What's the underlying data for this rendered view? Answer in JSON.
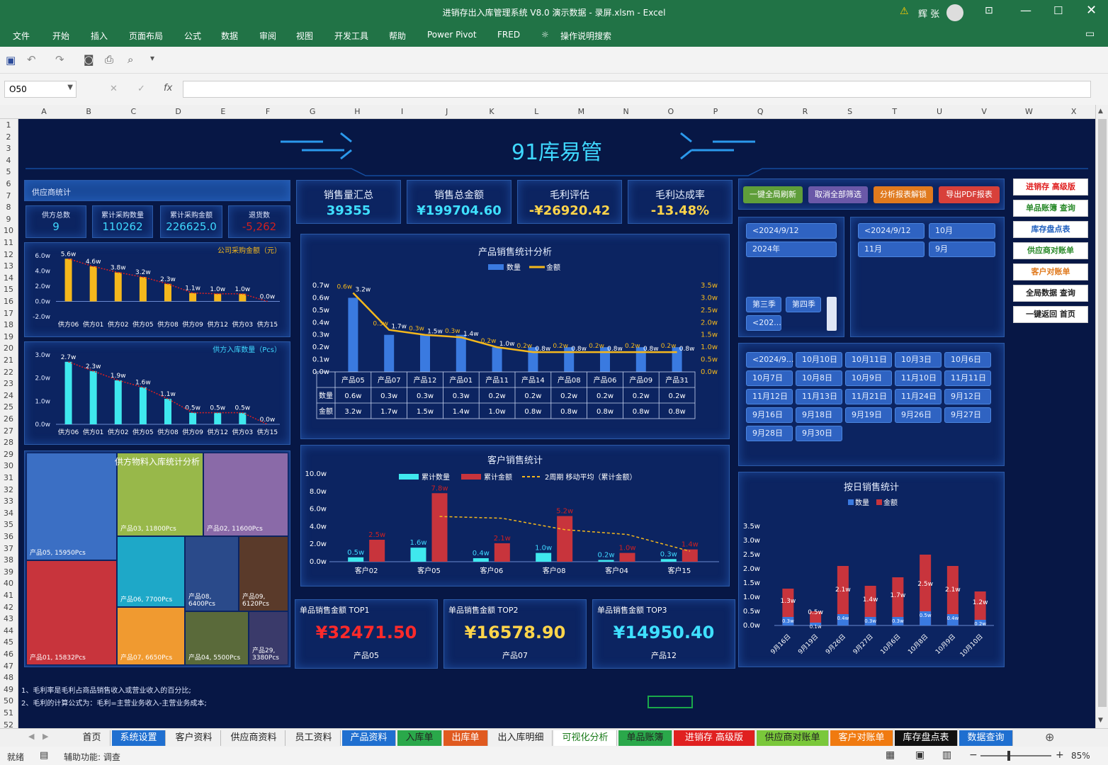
{
  "window": {
    "title": "进销存出入库管理系统 V8.0 演示数据 - 录屏.xlsm  -  Excel",
    "user": "辉 张"
  },
  "ribbon": {
    "tabs": [
      "文件",
      "开始",
      "插入",
      "页面布局",
      "公式",
      "数据",
      "审阅",
      "视图",
      "开发工具",
      "帮助",
      "Power Pivot",
      "FRED"
    ],
    "search": "操作说明搜索"
  },
  "formula": {
    "namebox": "O50",
    "fx": "fx"
  },
  "columns": [
    "A",
    "B",
    "C",
    "D",
    "E",
    "F",
    "G",
    "H",
    "I",
    "J",
    "K",
    "L",
    "M",
    "N",
    "O",
    "P",
    "Q",
    "R",
    "S",
    "T",
    "U",
    "V",
    "W",
    "X"
  ],
  "rows": [
    "1",
    "2",
    "3",
    "4",
    "5",
    "6",
    "7",
    "8",
    "9",
    "10",
    "11",
    "12",
    "13",
    "14",
    "15",
    "16",
    "17",
    "18",
    "19",
    "20",
    "21",
    "22",
    "23",
    "24",
    "25",
    "26",
    "27",
    "28",
    "29",
    "30",
    "31",
    "32",
    "33",
    "34",
    "35",
    "36",
    "37",
    "38",
    "39",
    "40",
    "41",
    "42",
    "43",
    "44",
    "45",
    "46",
    "47",
    "48",
    "49",
    "50",
    "51",
    "52"
  ],
  "dashboard": {
    "title": "91库易管",
    "supplier_header": "供应商统计",
    "supplier_kpis": [
      {
        "label": "供方总数",
        "value": "9"
      },
      {
        "label": "累计采购数量",
        "value": "110262"
      },
      {
        "label": "累计采购金额",
        "value": "226625.0"
      },
      {
        "label": "退货数",
        "value": "-5,262"
      }
    ],
    "kpis": [
      {
        "label": "销售量汇总",
        "value": "39355",
        "color": "#3fe0ff"
      },
      {
        "label": "销售总金额",
        "value": "¥199704.60",
        "color": "#3fe0ff"
      },
      {
        "label": "毛利评估",
        "value": "-¥26920.42",
        "color": "#ffd54a"
      },
      {
        "label": "毛利达成率",
        "value": "-13.48%",
        "color": "#ffd54a"
      }
    ],
    "action_buttons": [
      {
        "label": "一键全局刷新",
        "color": "#5f9e3a"
      },
      {
        "label": "取消全部筛选",
        "color": "#6a58a8"
      },
      {
        "label": "分析报表解锁",
        "color": "#e07a1e"
      },
      {
        "label": "导出PDF报表",
        "color": "#d8403a"
      }
    ],
    "nav_buttons": [
      {
        "label": "进销存 高级版",
        "color": "#e02020"
      },
      {
        "label": "单品账簿 查询",
        "color": "#2a8a2a"
      },
      {
        "label": "库存盘点表",
        "color": "#1f5fbf"
      },
      {
        "label": "供应商对账单",
        "color": "#2a8a2a"
      },
      {
        "label": "客户对账单",
        "color": "#e07a1e"
      },
      {
        "label": "全局数据 查询",
        "color": "#222222"
      },
      {
        "label": "一键返回 首页",
        "color": "#222222"
      }
    ],
    "slicer1": [
      "<2024/9/12",
      "2024年"
    ],
    "slicer1_bottom": [
      "第三季",
      "第四季",
      "<202..."
    ],
    "slicer2": [
      "<2024/9/12",
      "10月",
      "11月",
      "9月"
    ],
    "slicer_days": [
      "<2024/9...",
      "10月10日",
      "10月11日",
      "10月3日",
      "10月6日",
      "10月7日",
      "10月8日",
      "10月9日",
      "11月10日",
      "11月11日",
      "11月12日",
      "11月13日",
      "11月21日",
      "11月24日",
      "9月12日",
      "9月16日",
      "9月18日",
      "9月19日",
      "9月26日",
      "9月27日",
      "9月28日",
      "9月30日"
    ],
    "top_products": [
      {
        "label": "单品销售金额 TOP1",
        "value": "¥32471.50",
        "name": "产品05",
        "color": "#ff2a2a"
      },
      {
        "label": "单品销售金额 TOP2",
        "value": "¥16578.90",
        "name": "产品07",
        "color": "#ffd54a"
      },
      {
        "label": "单品销售金额 TOP3",
        "value": "¥14950.40",
        "name": "产品12",
        "color": "#3fe0ff"
      }
    ],
    "notes": [
      "1、毛利率是毛利占商品销售收入或营业收入的百分比;",
      "2、毛利的计算公式为：毛利=主营业务收入-主营业务成本;"
    ]
  },
  "chart_data": [
    {
      "type": "bar",
      "title": "公司采购金额（元）",
      "categories": [
        "供方06",
        "供方01",
        "供方02",
        "供方05",
        "供方08",
        "供方09",
        "供方12",
        "供方03",
        "供方15"
      ],
      "values": [
        5.6,
        4.6,
        3.8,
        3.2,
        2.3,
        1.1,
        1.0,
        1.0,
        0.0
      ],
      "labels": [
        "5.6w",
        "4.6w",
        "3.8w",
        "3.2w",
        "2.3w",
        "1.1w",
        "1.0w",
        "1.0w",
        "0.0w"
      ],
      "ylim": [
        -2,
        6
      ],
      "yticks": [
        "6.0w",
        "4.0w",
        "2.0w",
        "0.0w",
        "-2.0w"
      ],
      "color": "#f5b81c"
    },
    {
      "type": "bar",
      "title": "供方入库数量（Pcs）",
      "categories": [
        "供方06",
        "供方01",
        "供方02",
        "供方05",
        "供方08",
        "供方09",
        "供方12",
        "供方03",
        "供方15"
      ],
      "values": [
        2.7,
        2.3,
        1.9,
        1.6,
        1.1,
        0.5,
        0.5,
        0.5,
        0.0
      ],
      "labels": [
        "2.7w",
        "2.3w",
        "1.9w",
        "1.6w",
        "1.1w",
        "0.5w",
        "0.5w",
        "0.5w",
        "0.0w"
      ],
      "ylim": [
        0,
        3
      ],
      "yticks": [
        "3.0w",
        "2.0w",
        "1.0w",
        "0.0w"
      ],
      "color": "#3fe8ee"
    },
    {
      "type": "treemap",
      "title": "供方物料入库统计分析",
      "items": [
        {
          "name": "产品05, 15950Pcs",
          "value": 15950,
          "color": "#3b6fc4"
        },
        {
          "name": "产品01, 15832Pcs",
          "value": 15832,
          "color": "#c8343c"
        },
        {
          "name": "产品03, 11800Pcs",
          "value": 11800,
          "color": "#98b84a"
        },
        {
          "name": "产品02, 11600Pcs",
          "value": 11600,
          "color": "#8a6aa8"
        },
        {
          "name": "产品06, 7700Pcs",
          "value": 7700,
          "color": "#1ea8c8"
        },
        {
          "name": "产品08, 6400Pcs",
          "value": 6400,
          "color": "#2a4a8a"
        },
        {
          "name": "产品09, 6120Pcs",
          "value": 6120,
          "color": "#5a3a2a"
        },
        {
          "name": "产品07, 6650Pcs",
          "value": 6650,
          "color": "#f09a30"
        },
        {
          "name": "产品04, 5500Pcs",
          "value": 5500,
          "color": "#5a6a3a"
        },
        {
          "name": "产品29, 3380Pcs",
          "value": 3380,
          "color": "#3a3a6a"
        }
      ]
    },
    {
      "type": "bar",
      "title": "产品销售统计分析",
      "legend": [
        "数量",
        "金额"
      ],
      "categories": [
        "产品05",
        "产品07",
        "产品12",
        "产品01",
        "产品11",
        "产品14",
        "产品08",
        "产品06",
        "产品09",
        "产品31"
      ],
      "series": [
        {
          "name": "数量",
          "values": [
            0.6,
            0.3,
            0.3,
            0.3,
            0.2,
            0.2,
            0.2,
            0.2,
            0.2,
            0.2
          ],
          "labels": [
            "0.6w",
            "0.3w",
            "0.3w",
            "0.3w",
            "0.2w",
            "0.2w",
            "0.2w",
            "0.2w",
            "0.2w",
            "0.2w"
          ]
        },
        {
          "name": "金额",
          "values": [
            3.2,
            1.7,
            1.5,
            1.4,
            1.0,
            0.8,
            0.8,
            0.8,
            0.8,
            0.8
          ],
          "labels": [
            "3.2w",
            "1.7w",
            "1.5w",
            "1.4w",
            "1.0w",
            "0.8w",
            "0.8w",
            "0.8w",
            "0.8w",
            "0.8w"
          ]
        }
      ],
      "yticks_left": [
        "0.7w",
        "0.6w",
        "0.5w",
        "0.4w",
        "0.3w",
        "0.2w",
        "0.1w",
        "0.0w"
      ],
      "yticks_right": [
        "3.5w",
        "3.0w",
        "2.5w",
        "2.0w",
        "1.5w",
        "1.0w",
        "0.5w",
        "0.0w"
      ],
      "table_rows": [
        "数量",
        "金额"
      ]
    },
    {
      "type": "bar",
      "title": "客户销售统计",
      "legend": [
        "累计数量",
        "累计金额",
        "2周期 移动平均（累计金额）"
      ],
      "categories": [
        "客户02",
        "客户05",
        "客户06",
        "客户08",
        "客户04",
        "客户15"
      ],
      "series": [
        {
          "name": "累计数量",
          "values": [
            0.5,
            1.6,
            0.4,
            1.0,
            0.2,
            0.3
          ],
          "labels": [
            "0.5w",
            "1.6w",
            "0.4w",
            "1.0w",
            "0.2w",
            "0.3w"
          ]
        },
        {
          "name": "累计金额",
          "values": [
            2.5,
            7.8,
            2.1,
            5.2,
            1.0,
            1.4
          ],
          "labels": [
            "2.5w",
            "7.8w",
            "2.1w",
            "5.2w",
            "1.0w",
            "1.4w"
          ]
        }
      ],
      "yticks": [
        "10.0w",
        "8.0w",
        "6.0w",
        "4.0w",
        "2.0w",
        "0.0w"
      ],
      "ylim": [
        0,
        10
      ]
    },
    {
      "type": "bar",
      "title": "按日销售统计",
      "legend": [
        "数量",
        "金额"
      ],
      "categories": [
        "9月16日",
        "9月19日",
        "9月26日",
        "9月27日",
        "10月6日",
        "10月8日",
        "10月9日",
        "10月10日"
      ],
      "series": [
        {
          "name": "数量",
          "values": [
            0.3,
            0.1,
            0.4,
            0.3,
            0.3,
            0.5,
            0.4,
            0.2
          ],
          "labels": [
            "0.3w",
            "0.1w",
            "0.4w",
            "0.3w",
            "0.3w",
            "0.5w",
            "0.4w",
            "0.2w"
          ]
        },
        {
          "name": "金额",
          "values": [
            1.3,
            0.5,
            2.1,
            1.4,
            1.7,
            2.5,
            2.1,
            1.2
          ],
          "labels": [
            "1.3w",
            "0.5w",
            "2.1w",
            "1.4w",
            "1.7w",
            "2.5w",
            "2.1w",
            "1.2w"
          ]
        }
      ],
      "yticks": [
        "3.5w",
        "3.0w",
        "2.5w",
        "2.0w",
        "1.5w",
        "1.0w",
        "0.5w",
        "0.0w"
      ],
      "ylim": [
        0,
        3.5
      ]
    }
  ],
  "sheet_tabs": [
    {
      "label": "首页",
      "bg": "#f0f0f0",
      "fg": "#222"
    },
    {
      "label": "系统设置",
      "bg": "#1f6fd0",
      "fg": "#fff"
    },
    {
      "label": "客户资料",
      "bg": "#f0f0f0",
      "fg": "#222"
    },
    {
      "label": "供应商资料",
      "bg": "#f0f0f0",
      "fg": "#222"
    },
    {
      "label": "员工资料",
      "bg": "#f0f0f0",
      "fg": "#222"
    },
    {
      "label": "产品资料",
      "bg": "#1f6fd0",
      "fg": "#fff"
    },
    {
      "label": "入库单",
      "bg": "#2aa84a",
      "fg": "#222"
    },
    {
      "label": "出库单",
      "bg": "#e05a20",
      "fg": "#fff"
    },
    {
      "label": "出入库明细",
      "bg": "#f0f0f0",
      "fg": "#222"
    },
    {
      "label": "可视化分析",
      "bg": "#ffffff",
      "fg": "#1a7a1a"
    },
    {
      "label": "单品账簿",
      "bg": "#2aa84a",
      "fg": "#222"
    },
    {
      "label": "进销存 高级版",
      "bg": "#e02020",
      "fg": "#fff"
    },
    {
      "label": "供应商对账单",
      "bg": "#7ac83a",
      "fg": "#222"
    },
    {
      "label": "客户对账单",
      "bg": "#f07a10",
      "fg": "#fff"
    },
    {
      "label": "库存盘点表",
      "bg": "#111111",
      "fg": "#fff"
    },
    {
      "label": "数据查询",
      "bg": "#1f6fd0",
      "fg": "#fff"
    }
  ],
  "status": {
    "ready": "就绪",
    "accessibility": "辅助功能: 调查",
    "zoom": "85%"
  }
}
